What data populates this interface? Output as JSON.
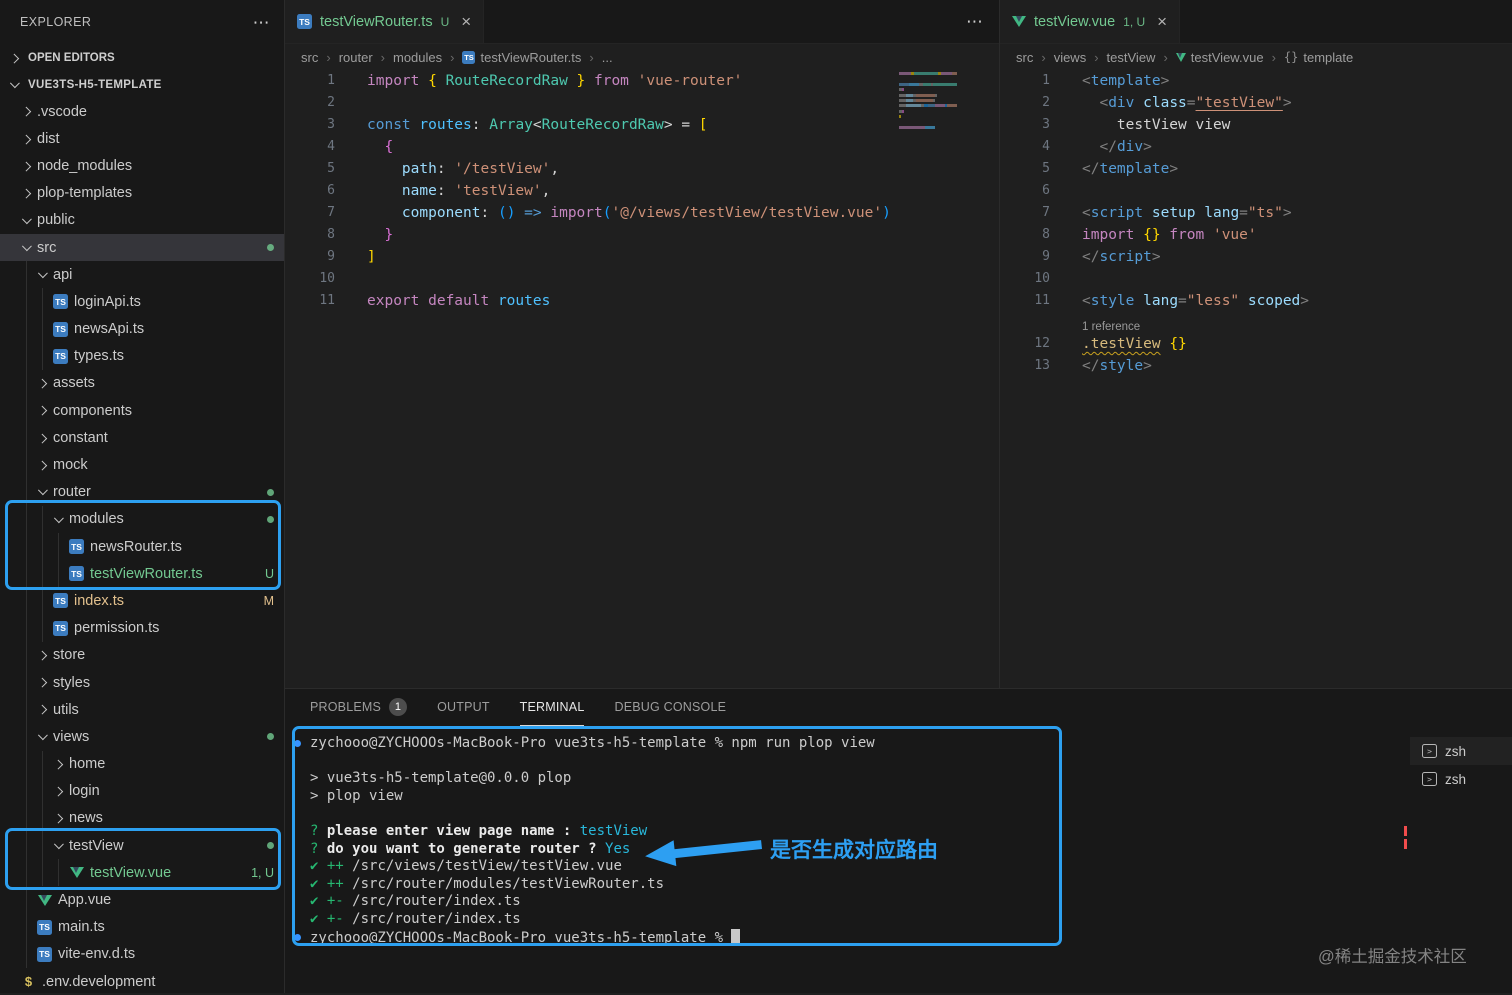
{
  "icons": {
    "more": "⋯",
    "close": "×",
    "crumb_sep": "›",
    "template_symbol": "{}",
    "check": "✔",
    "terminal_prompt": ">"
  },
  "sidebar": {
    "title": "EXPLORER",
    "open_editors_label": "OPEN EDITORS",
    "project_label": "VUE3TS-H5-TEMPLATE",
    "tree": [
      {
        "indent": 0,
        "type": "folder",
        "chev": ">",
        "label": ".vscode"
      },
      {
        "indent": 0,
        "type": "folder",
        "chev": ">",
        "label": "dist"
      },
      {
        "indent": 0,
        "type": "folder",
        "chev": ">",
        "label": "node_modules"
      },
      {
        "indent": 0,
        "type": "folder",
        "chev": ">",
        "label": "plop-templates"
      },
      {
        "indent": 0,
        "type": "folder",
        "chev": "v",
        "label": "public"
      },
      {
        "indent": 0,
        "type": "folder",
        "chev": "v",
        "label": "src",
        "selected": true,
        "dot": true
      },
      {
        "indent": 1,
        "type": "folder",
        "chev": "v",
        "label": "api"
      },
      {
        "indent": 2,
        "type": "file",
        "icon": "TS",
        "label": "loginApi.ts"
      },
      {
        "indent": 2,
        "type": "file",
        "icon": "TS",
        "label": "newsApi.ts"
      },
      {
        "indent": 2,
        "type": "file",
        "icon": "TS",
        "label": "types.ts"
      },
      {
        "indent": 1,
        "type": "folder",
        "chev": ">",
        "label": "assets"
      },
      {
        "indent": 1,
        "type": "folder",
        "chev": ">",
        "label": "components"
      },
      {
        "indent": 1,
        "type": "folder",
        "chev": ">",
        "label": "constant"
      },
      {
        "indent": 1,
        "type": "folder",
        "chev": ">",
        "label": "mock"
      },
      {
        "indent": 1,
        "type": "folder",
        "chev": "v",
        "label": "router",
        "dot": true
      },
      {
        "indent": 2,
        "type": "folder",
        "chev": "v",
        "label": "modules",
        "dot": true
      },
      {
        "indent": 3,
        "type": "file",
        "icon": "TS",
        "label": "newsRouter.ts"
      },
      {
        "indent": 3,
        "type": "file",
        "icon": "TS",
        "label": "testViewRouter.ts",
        "badge": "U",
        "green": true
      },
      {
        "indent": 2,
        "type": "file",
        "icon": "TS",
        "label": "index.ts",
        "badge": "M",
        "mod": true
      },
      {
        "indent": 2,
        "type": "file",
        "icon": "TS",
        "label": "permission.ts"
      },
      {
        "indent": 1,
        "type": "folder",
        "chev": ">",
        "label": "store"
      },
      {
        "indent": 1,
        "type": "folder",
        "chev": ">",
        "label": "styles"
      },
      {
        "indent": 1,
        "type": "folder",
        "chev": ">",
        "label": "utils"
      },
      {
        "indent": 1,
        "type": "folder",
        "chev": "v",
        "label": "views",
        "dot": true
      },
      {
        "indent": 2,
        "type": "folder",
        "chev": ">",
        "label": "home"
      },
      {
        "indent": 2,
        "type": "folder",
        "chev": ">",
        "label": "login"
      },
      {
        "indent": 2,
        "type": "folder",
        "chev": ">",
        "label": "news"
      },
      {
        "indent": 2,
        "type": "folder",
        "chev": "v",
        "label": "testView",
        "dot": true
      },
      {
        "indent": 3,
        "type": "file",
        "icon": "vue",
        "label": "testView.vue",
        "badge": "1, U",
        "green": true
      },
      {
        "indent": 1,
        "type": "file",
        "icon": "vue",
        "label": "App.vue"
      },
      {
        "indent": 1,
        "type": "file",
        "icon": "TS",
        "label": "main.ts"
      },
      {
        "indent": 1,
        "type": "file",
        "icon": "TS",
        "label": "vite-env.d.ts"
      },
      {
        "indent": 0,
        "type": "file",
        "icon": "env",
        "label": ".env.development"
      }
    ]
  },
  "editor_left": {
    "tab": {
      "icon": "TS",
      "label": "testViewRouter.ts",
      "badge": "U"
    },
    "breadcrumb": [
      {
        "label": "src"
      },
      {
        "label": "router"
      },
      {
        "label": "modules"
      },
      {
        "icon": "ts",
        "label": "testViewRouter.ts"
      },
      {
        "label": "..."
      }
    ],
    "lines": [
      {
        "n": "1",
        "tokens": [
          [
            "kw",
            "import "
          ],
          [
            "br1",
            "{ "
          ],
          [
            "type",
            "RouteRecordRaw"
          ],
          [
            "br1",
            " }"
          ],
          [
            "kw",
            " from "
          ],
          [
            "str",
            "'vue-router'"
          ]
        ]
      },
      {
        "n": "2",
        "tokens": []
      },
      {
        "n": "3",
        "tokens": [
          [
            "blue",
            "const "
          ],
          [
            "cvar",
            "routes"
          ],
          [
            "pun",
            ": "
          ],
          [
            "type",
            "Array"
          ],
          [
            "pun",
            "<"
          ],
          [
            "type",
            "RouteRecordRaw"
          ],
          [
            "pun",
            "> = "
          ],
          [
            "br1",
            "["
          ]
        ]
      },
      {
        "n": "4",
        "tokens": [
          [
            "pun",
            "  "
          ],
          [
            "br2",
            "{"
          ]
        ]
      },
      {
        "n": "5",
        "tokens": [
          [
            "pun",
            "    "
          ],
          [
            "var",
            "path"
          ],
          [
            "pun",
            ": "
          ],
          [
            "str",
            "'/testView'"
          ],
          [
            "pun",
            ","
          ]
        ]
      },
      {
        "n": "6",
        "tokens": [
          [
            "pun",
            "    "
          ],
          [
            "var",
            "name"
          ],
          [
            "pun",
            ": "
          ],
          [
            "str",
            "'testView'"
          ],
          [
            "pun",
            ","
          ]
        ]
      },
      {
        "n": "7",
        "tokens": [
          [
            "pun",
            "    "
          ],
          [
            "var",
            "component"
          ],
          [
            "pun",
            ": "
          ],
          [
            "br3",
            "()"
          ],
          [
            "blue",
            " => "
          ],
          [
            "kw",
            "import"
          ],
          [
            "br3",
            "("
          ],
          [
            "str",
            "'@/views/testView/testView.vue'"
          ],
          [
            "br3",
            ")"
          ]
        ]
      },
      {
        "n": "8",
        "tokens": [
          [
            "pun",
            "  "
          ],
          [
            "br2",
            "}"
          ]
        ]
      },
      {
        "n": "9",
        "tokens": [
          [
            "br1",
            "]"
          ]
        ]
      },
      {
        "n": "10",
        "tokens": []
      },
      {
        "n": "11",
        "tokens": [
          [
            "kw",
            "export default "
          ],
          [
            "cvar",
            "routes"
          ]
        ]
      }
    ]
  },
  "editor_right": {
    "tab": {
      "icon": "vue",
      "label": "testView.vue",
      "badge": "1, U"
    },
    "breadcrumb": [
      {
        "label": "src"
      },
      {
        "label": "views"
      },
      {
        "label": "testView"
      },
      {
        "icon": "vue",
        "label": "testView.vue"
      },
      {
        "icon": "sym",
        "label": "template"
      }
    ],
    "lines": [
      {
        "n": "1",
        "tokens": [
          [
            "abr",
            "<"
          ],
          [
            "tag",
            "template"
          ],
          [
            "abr",
            ">"
          ]
        ]
      },
      {
        "n": "2",
        "tokens": [
          [
            "pun",
            "  "
          ],
          [
            "abr",
            "<"
          ],
          [
            "tag",
            "div"
          ],
          [
            "pun",
            " "
          ],
          [
            "attr",
            "class"
          ],
          [
            "abr",
            "="
          ],
          [
            "stru",
            "\"testView\""
          ],
          [
            "abr",
            ">"
          ]
        ]
      },
      {
        "n": "3",
        "tokens": [
          [
            "txt",
            "    testView view"
          ]
        ]
      },
      {
        "n": "4",
        "tokens": [
          [
            "pun",
            "  "
          ],
          [
            "abr",
            "</"
          ],
          [
            "tag",
            "div"
          ],
          [
            "abr",
            ">"
          ]
        ]
      },
      {
        "n": "5",
        "tokens": [
          [
            "abr",
            "</"
          ],
          [
            "tag",
            "template"
          ],
          [
            "abr",
            ">"
          ]
        ]
      },
      {
        "n": "6",
        "tokens": []
      },
      {
        "n": "7",
        "tokens": [
          [
            "abr",
            "<"
          ],
          [
            "tag",
            "script"
          ],
          [
            "pun",
            " "
          ],
          [
            "attr",
            "setup"
          ],
          [
            "pun",
            " "
          ],
          [
            "attr",
            "lang"
          ],
          [
            "abr",
            "="
          ],
          [
            "str",
            "\"ts\""
          ],
          [
            "abr",
            ">"
          ]
        ]
      },
      {
        "n": "8",
        "tokens": [
          [
            "kw",
            "import "
          ],
          [
            "br1",
            "{}"
          ],
          [
            "kw",
            " from "
          ],
          [
            "str",
            "'vue'"
          ]
        ]
      },
      {
        "n": "9",
        "tokens": [
          [
            "abr",
            "</"
          ],
          [
            "tag",
            "script"
          ],
          [
            "abr",
            ">"
          ]
        ]
      },
      {
        "n": "10",
        "tokens": []
      },
      {
        "n": "11",
        "tokens": [
          [
            "abr",
            "<"
          ],
          [
            "tag",
            "style"
          ],
          [
            "pun",
            " "
          ],
          [
            "attr",
            "lang"
          ],
          [
            "abr",
            "="
          ],
          [
            "str",
            "\"less\""
          ],
          [
            "pun",
            " "
          ],
          [
            "attr",
            "scoped"
          ],
          [
            "abr",
            ">"
          ]
        ]
      },
      {
        "lens": "1 reference"
      },
      {
        "n": "12",
        "tokens": [
          [
            "clsu",
            ".testView"
          ],
          [
            "pun",
            " "
          ],
          [
            "br1",
            "{}"
          ]
        ]
      },
      {
        "n": "13",
        "tokens": [
          [
            "abr",
            "</"
          ],
          [
            "tag",
            "style"
          ],
          [
            "abr",
            ">"
          ]
        ]
      }
    ]
  },
  "panel": {
    "tabs": [
      {
        "label": "PROBLEMS",
        "badge": "1"
      },
      {
        "label": "OUTPUT"
      },
      {
        "label": "TERMINAL",
        "active": true
      },
      {
        "label": "DEBUG CONSOLE"
      }
    ],
    "terminal_lines": [
      {
        "dot": true,
        "tokens": [
          [
            "td",
            "zychooo@ZYCHOOOs-MacBook-Pro vue3ts-h5-template % npm run plop view"
          ]
        ]
      },
      {
        "tokens": []
      },
      {
        "tokens": [
          [
            "td",
            "> vue3ts-h5-template@0.0.0 plop"
          ]
        ]
      },
      {
        "tokens": [
          [
            "td",
            "> plop view"
          ]
        ]
      },
      {
        "tokens": []
      },
      {
        "tokens": [
          [
            "tg",
            "? "
          ],
          [
            "tb",
            "please enter view page name : "
          ],
          [
            "tc",
            "testView"
          ]
        ]
      },
      {
        "tokens": [
          [
            "tg",
            "? "
          ],
          [
            "tb",
            "do you want to generate router ? "
          ],
          [
            "tc",
            "Yes"
          ]
        ]
      },
      {
        "tokens": [
          [
            "tg",
            "✔ ++ "
          ],
          [
            "td",
            "/src/views/testView/testView.vue"
          ]
        ]
      },
      {
        "tokens": [
          [
            "tg",
            "✔ ++ "
          ],
          [
            "td",
            "/src/router/modules/testViewRouter.ts"
          ]
        ]
      },
      {
        "tokens": [
          [
            "tg",
            "✔ +- "
          ],
          [
            "td",
            "/src/router/index.ts"
          ]
        ]
      },
      {
        "tokens": [
          [
            "tg",
            "✔ +- "
          ],
          [
            "td",
            "/src/router/index.ts"
          ]
        ]
      },
      {
        "dot": true,
        "cursor": true,
        "tokens": [
          [
            "td",
            "zychooo@ZYCHOOOs-MacBook-Pro vue3ts-h5-template % "
          ]
        ]
      }
    ],
    "terminals_list": [
      {
        "label": "zsh"
      },
      {
        "label": "zsh"
      }
    ]
  },
  "annotation": {
    "text": "是否生成对应路由"
  },
  "watermark": "@稀土掘金技术社区"
}
